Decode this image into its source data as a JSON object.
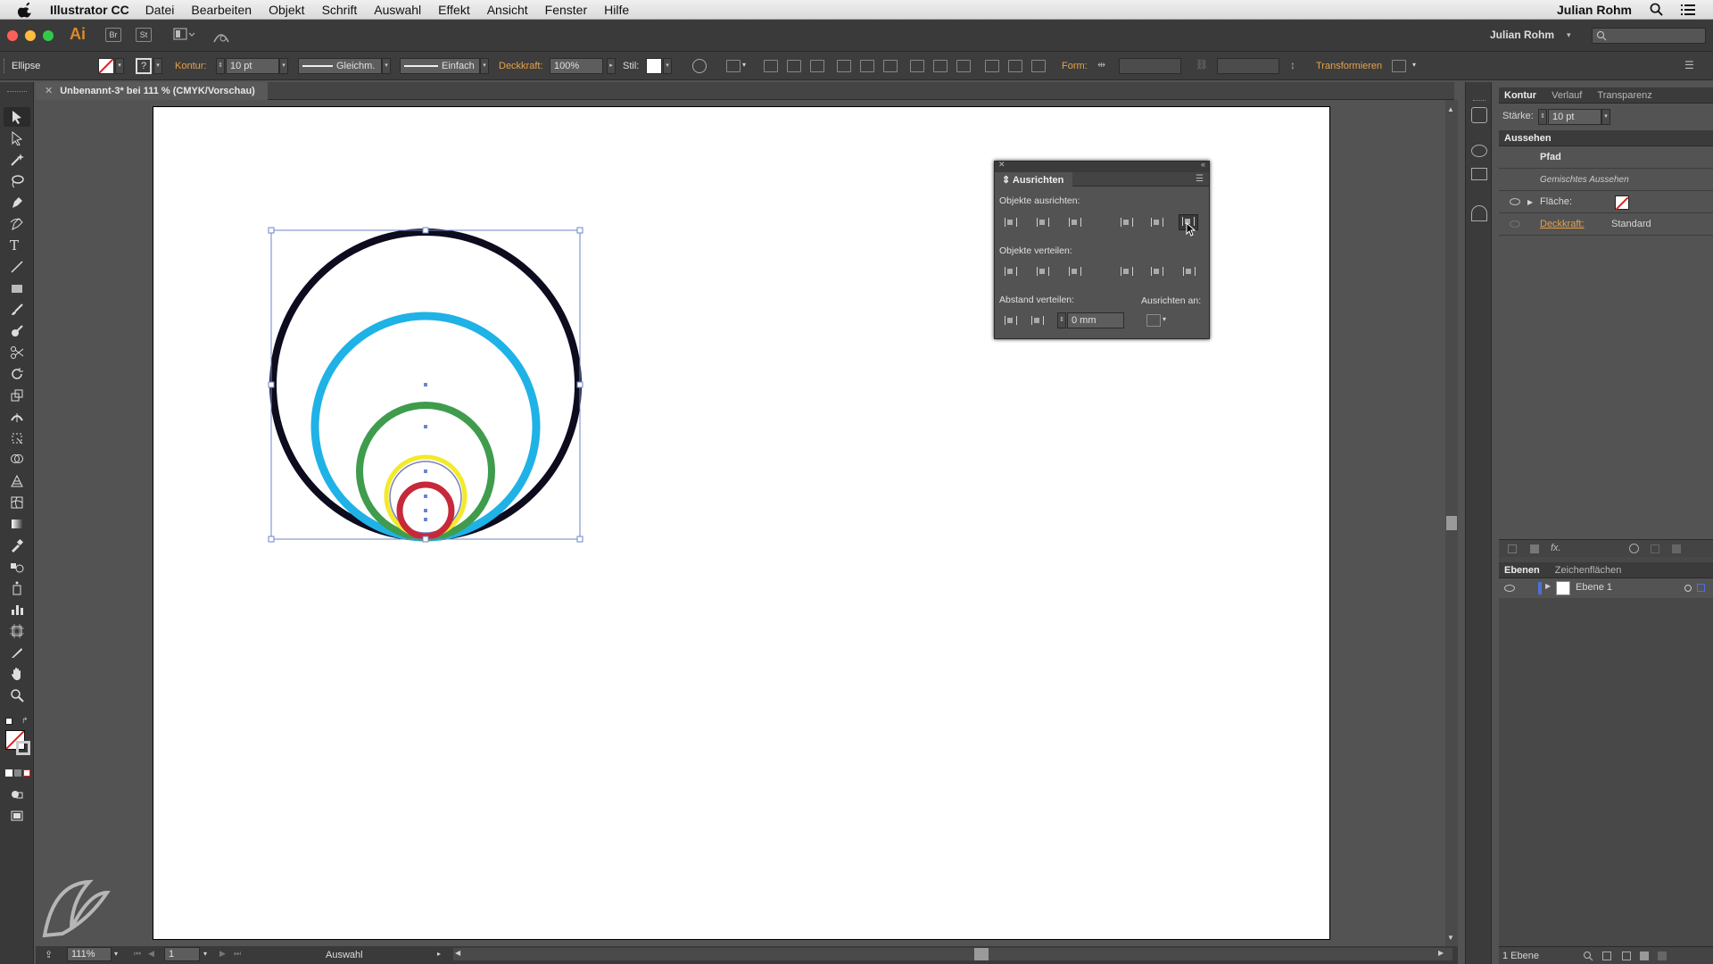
{
  "menubar": {
    "app": "Illustrator CC",
    "items": [
      "Datei",
      "Bearbeiten",
      "Objekt",
      "Schrift",
      "Auswahl",
      "Effekt",
      "Ansicht",
      "Fenster",
      "Hilfe"
    ],
    "user": "Julian Rohm"
  },
  "appbar": {
    "logo": "Ai",
    "br": "Br",
    "st": "St",
    "workspace_user": "Julian Rohm"
  },
  "control": {
    "selection_type": "Ellipse",
    "kontur_label": "Kontur:",
    "kontur_value": "10 pt",
    "profile": "Gleichm.",
    "brush": "Einfach",
    "deckkraft_label": "Deckkraft:",
    "deckkraft_value": "100%",
    "stil_label": "Stil:",
    "form_label": "Form:",
    "transform_label": "Transformieren"
  },
  "document": {
    "tab_title": "Unbenannt-3* bei 111 % (CMYK/Vorschau)"
  },
  "status": {
    "zoom": "111%",
    "artboard": "1",
    "mode": "Auswahl"
  },
  "align_panel": {
    "title": "Ausrichten",
    "align_objects": "Objekte ausrichten:",
    "distribute_objects": "Objekte verteilen:",
    "distribute_spacing": "Abstand verteilen:",
    "align_to": "Ausrichten an:",
    "spacing_value": "0 mm"
  },
  "stroke_panel": {
    "tabs": [
      "Kontur",
      "Verlauf",
      "Transparenz"
    ],
    "weight_label": "Stärke:",
    "weight_value": "10 pt"
  },
  "appearance_panel": {
    "title": "Aussehen",
    "path": "Pfad",
    "mixed": "Gemischtes Aussehen",
    "fill_label": "Fläche:",
    "opacity_label": "Deckkraft:",
    "opacity_value": "Standard"
  },
  "layers_panel": {
    "tabs": [
      "Ebenen",
      "Zeichenflächen"
    ],
    "layer_name": "Ebene 1",
    "footer": "1 Ebene"
  },
  "colors": {
    "circle_black": "#0d0b1e",
    "circle_blue": "#1fb2e6",
    "circle_green": "#3f9c4d",
    "circle_yellow": "#f3ea2a",
    "circle_red": "#c7293a",
    "selection": "#6b86c9"
  }
}
